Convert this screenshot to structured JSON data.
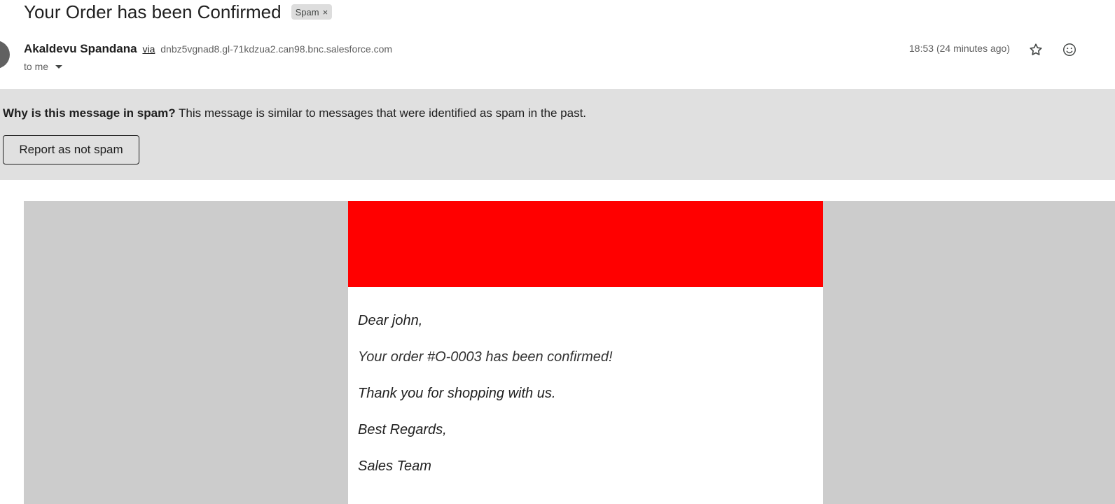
{
  "message": {
    "subject": "Your Order has been Confirmed",
    "label": "Spam",
    "label_remove": "×",
    "sender_name": "Akaldevu Spandana",
    "via": "via",
    "sender_domain": "dnbz5vgnad8.gl-71kdzua2.can98.bnc.salesforce.com",
    "to": "to me",
    "timestamp": "18:53 (24 minutes ago)"
  },
  "spam_banner": {
    "question": "Why is this message in spam?",
    "explanation": " This message is similar to messages that were identified as spam in the past.",
    "button_label": "Report as not spam"
  },
  "email_content": {
    "header_color": "#ff0000",
    "lines": [
      "Dear john,",
      "Your order #O-0003 has been confirmed!",
      "Thank you for shopping with us.",
      "Best Regards,",
      "Sales Team"
    ]
  },
  "icons": {
    "star": "star-icon",
    "emoji": "add-reaction-icon",
    "caret": "chevron-down-icon"
  }
}
